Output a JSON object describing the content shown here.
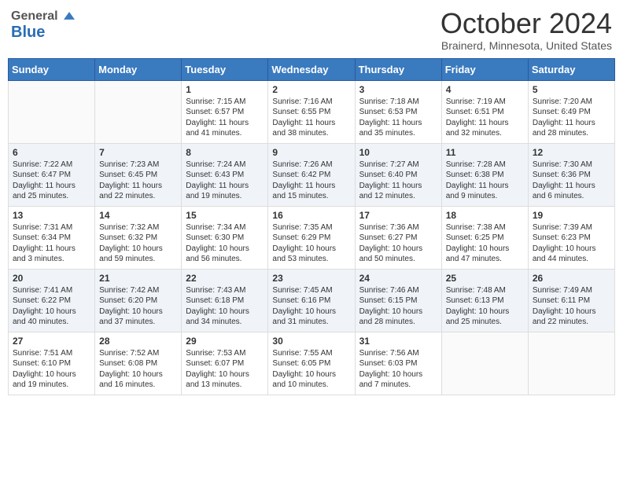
{
  "header": {
    "logo_general": "General",
    "logo_blue": "Blue",
    "month_title": "October 2024",
    "location": "Brainerd, Minnesota, United States"
  },
  "days_of_week": [
    "Sunday",
    "Monday",
    "Tuesday",
    "Wednesday",
    "Thursday",
    "Friday",
    "Saturday"
  ],
  "weeks": [
    [
      {
        "day": "",
        "sunrise": "",
        "sunset": "",
        "daylight": ""
      },
      {
        "day": "",
        "sunrise": "",
        "sunset": "",
        "daylight": ""
      },
      {
        "day": "1",
        "sunrise": "Sunrise: 7:15 AM",
        "sunset": "Sunset: 6:57 PM",
        "daylight": "Daylight: 11 hours and 41 minutes."
      },
      {
        "day": "2",
        "sunrise": "Sunrise: 7:16 AM",
        "sunset": "Sunset: 6:55 PM",
        "daylight": "Daylight: 11 hours and 38 minutes."
      },
      {
        "day": "3",
        "sunrise": "Sunrise: 7:18 AM",
        "sunset": "Sunset: 6:53 PM",
        "daylight": "Daylight: 11 hours and 35 minutes."
      },
      {
        "day": "4",
        "sunrise": "Sunrise: 7:19 AM",
        "sunset": "Sunset: 6:51 PM",
        "daylight": "Daylight: 11 hours and 32 minutes."
      },
      {
        "day": "5",
        "sunrise": "Sunrise: 7:20 AM",
        "sunset": "Sunset: 6:49 PM",
        "daylight": "Daylight: 11 hours and 28 minutes."
      }
    ],
    [
      {
        "day": "6",
        "sunrise": "Sunrise: 7:22 AM",
        "sunset": "Sunset: 6:47 PM",
        "daylight": "Daylight: 11 hours and 25 minutes."
      },
      {
        "day": "7",
        "sunrise": "Sunrise: 7:23 AM",
        "sunset": "Sunset: 6:45 PM",
        "daylight": "Daylight: 11 hours and 22 minutes."
      },
      {
        "day": "8",
        "sunrise": "Sunrise: 7:24 AM",
        "sunset": "Sunset: 6:43 PM",
        "daylight": "Daylight: 11 hours and 19 minutes."
      },
      {
        "day": "9",
        "sunrise": "Sunrise: 7:26 AM",
        "sunset": "Sunset: 6:42 PM",
        "daylight": "Daylight: 11 hours and 15 minutes."
      },
      {
        "day": "10",
        "sunrise": "Sunrise: 7:27 AM",
        "sunset": "Sunset: 6:40 PM",
        "daylight": "Daylight: 11 hours and 12 minutes."
      },
      {
        "day": "11",
        "sunrise": "Sunrise: 7:28 AM",
        "sunset": "Sunset: 6:38 PM",
        "daylight": "Daylight: 11 hours and 9 minutes."
      },
      {
        "day": "12",
        "sunrise": "Sunrise: 7:30 AM",
        "sunset": "Sunset: 6:36 PM",
        "daylight": "Daylight: 11 hours and 6 minutes."
      }
    ],
    [
      {
        "day": "13",
        "sunrise": "Sunrise: 7:31 AM",
        "sunset": "Sunset: 6:34 PM",
        "daylight": "Daylight: 11 hours and 3 minutes."
      },
      {
        "day": "14",
        "sunrise": "Sunrise: 7:32 AM",
        "sunset": "Sunset: 6:32 PM",
        "daylight": "Daylight: 10 hours and 59 minutes."
      },
      {
        "day": "15",
        "sunrise": "Sunrise: 7:34 AM",
        "sunset": "Sunset: 6:30 PM",
        "daylight": "Daylight: 10 hours and 56 minutes."
      },
      {
        "day": "16",
        "sunrise": "Sunrise: 7:35 AM",
        "sunset": "Sunset: 6:29 PM",
        "daylight": "Daylight: 10 hours and 53 minutes."
      },
      {
        "day": "17",
        "sunrise": "Sunrise: 7:36 AM",
        "sunset": "Sunset: 6:27 PM",
        "daylight": "Daylight: 10 hours and 50 minutes."
      },
      {
        "day": "18",
        "sunrise": "Sunrise: 7:38 AM",
        "sunset": "Sunset: 6:25 PM",
        "daylight": "Daylight: 10 hours and 47 minutes."
      },
      {
        "day": "19",
        "sunrise": "Sunrise: 7:39 AM",
        "sunset": "Sunset: 6:23 PM",
        "daylight": "Daylight: 10 hours and 44 minutes."
      }
    ],
    [
      {
        "day": "20",
        "sunrise": "Sunrise: 7:41 AM",
        "sunset": "Sunset: 6:22 PM",
        "daylight": "Daylight: 10 hours and 40 minutes."
      },
      {
        "day": "21",
        "sunrise": "Sunrise: 7:42 AM",
        "sunset": "Sunset: 6:20 PM",
        "daylight": "Daylight: 10 hours and 37 minutes."
      },
      {
        "day": "22",
        "sunrise": "Sunrise: 7:43 AM",
        "sunset": "Sunset: 6:18 PM",
        "daylight": "Daylight: 10 hours and 34 minutes."
      },
      {
        "day": "23",
        "sunrise": "Sunrise: 7:45 AM",
        "sunset": "Sunset: 6:16 PM",
        "daylight": "Daylight: 10 hours and 31 minutes."
      },
      {
        "day": "24",
        "sunrise": "Sunrise: 7:46 AM",
        "sunset": "Sunset: 6:15 PM",
        "daylight": "Daylight: 10 hours and 28 minutes."
      },
      {
        "day": "25",
        "sunrise": "Sunrise: 7:48 AM",
        "sunset": "Sunset: 6:13 PM",
        "daylight": "Daylight: 10 hours and 25 minutes."
      },
      {
        "day": "26",
        "sunrise": "Sunrise: 7:49 AM",
        "sunset": "Sunset: 6:11 PM",
        "daylight": "Daylight: 10 hours and 22 minutes."
      }
    ],
    [
      {
        "day": "27",
        "sunrise": "Sunrise: 7:51 AM",
        "sunset": "Sunset: 6:10 PM",
        "daylight": "Daylight: 10 hours and 19 minutes."
      },
      {
        "day": "28",
        "sunrise": "Sunrise: 7:52 AM",
        "sunset": "Sunset: 6:08 PM",
        "daylight": "Daylight: 10 hours and 16 minutes."
      },
      {
        "day": "29",
        "sunrise": "Sunrise: 7:53 AM",
        "sunset": "Sunset: 6:07 PM",
        "daylight": "Daylight: 10 hours and 13 minutes."
      },
      {
        "day": "30",
        "sunrise": "Sunrise: 7:55 AM",
        "sunset": "Sunset: 6:05 PM",
        "daylight": "Daylight: 10 hours and 10 minutes."
      },
      {
        "day": "31",
        "sunrise": "Sunrise: 7:56 AM",
        "sunset": "Sunset: 6:03 PM",
        "daylight": "Daylight: 10 hours and 7 minutes."
      },
      {
        "day": "",
        "sunrise": "",
        "sunset": "",
        "daylight": ""
      },
      {
        "day": "",
        "sunrise": "",
        "sunset": "",
        "daylight": ""
      }
    ]
  ]
}
